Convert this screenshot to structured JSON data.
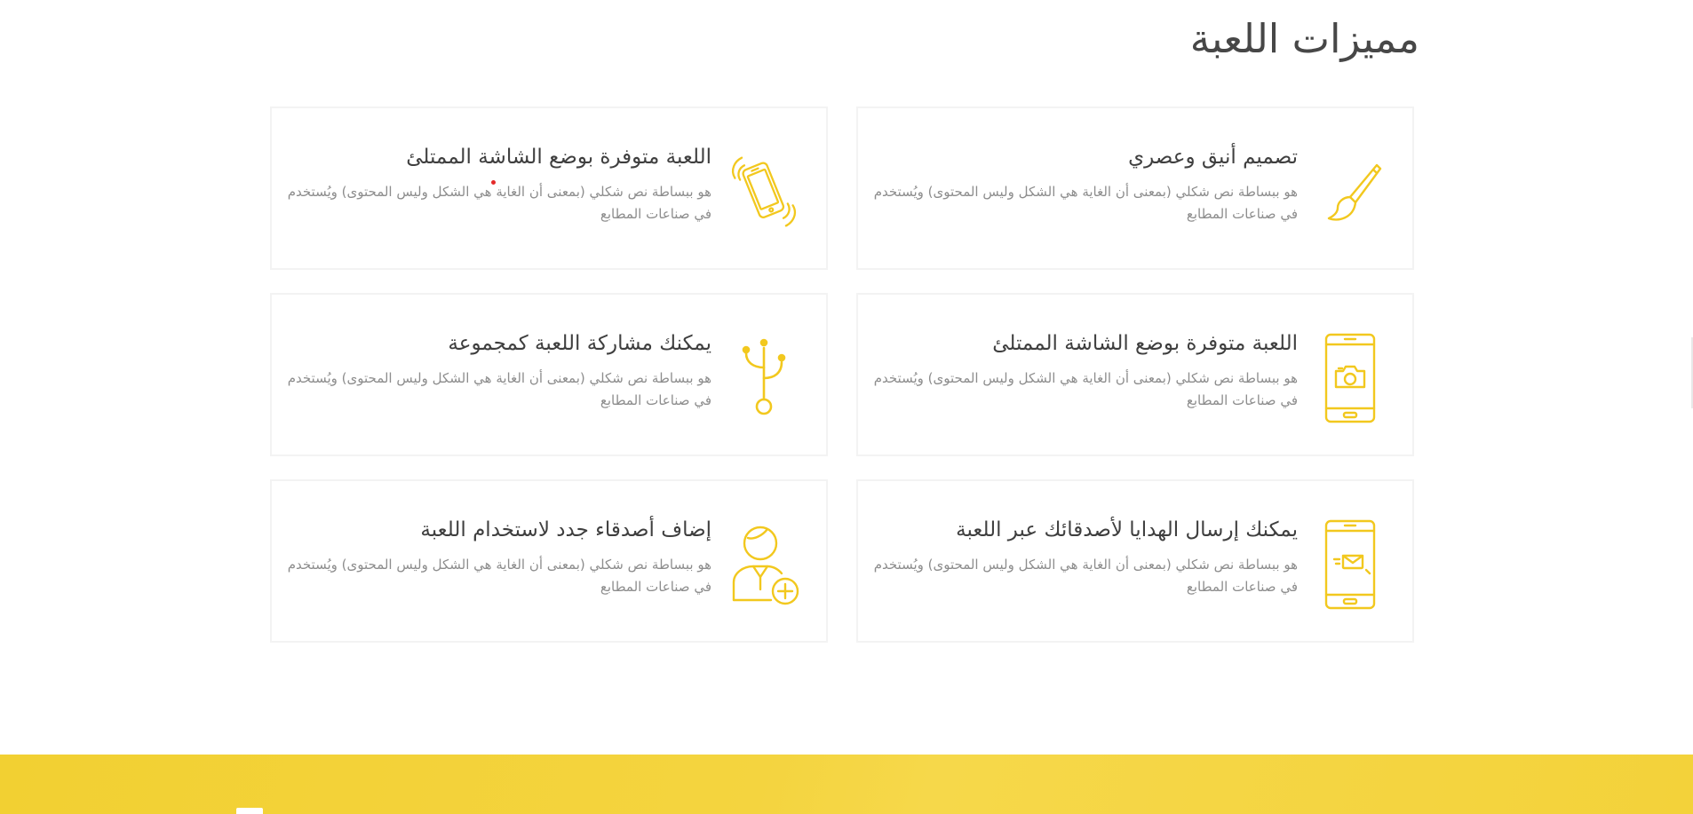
{
  "features": {
    "title": "مميزات اللعبة",
    "cards": [
      {
        "icon": "paintbrush-icon",
        "title": "تصميم أنيق وعصري",
        "description": "هو ببساطة نص شكلي (بمعنى أن الغاية هي الشكل وليس المحتوى) ويُستخدم في صناعات المطابع"
      },
      {
        "icon": "vibrating-phone-icon",
        "title": "اللعبة متوفرة بوضع الشاشة الممتلئ",
        "description": "هو ببساطة نص شكلي (بمعنى أن الغاية هي الشكل وليس المحتوى) ويُستخدم في صناعات المطابع"
      },
      {
        "icon": "phone-camera-icon",
        "title": "اللعبة متوفرة بوضع الشاشة الممتلئ",
        "description": "هو ببساطة نص شكلي (بمعنى أن الغاية هي الشكل وليس المحتوى) ويُستخدم في صناعات المطابع"
      },
      {
        "icon": "usb-icon",
        "title": "يمكنك مشاركة اللعبة كمجموعة",
        "description": "هو ببساطة نص شكلي (بمعنى أن الغاية هي الشكل وليس المحتوى) ويُستخدم في صناعات المطابع"
      },
      {
        "icon": "phone-message-icon",
        "title": "يمكنك إرسال الهدايا لأصدقائك عبر اللعبة",
        "description": "هو ببساطة نص شكلي (بمعنى أن الغاية هي الشكل وليس المحتوى) ويُستخدم في صناعات المطابع"
      },
      {
        "icon": "add-user-icon",
        "title": "إضاف أصدقاء جدد لاستخدام اللعبة",
        "description": "هو ببساطة نص شكلي (بمعنى أن الغاية هي الشكل وليس المحتوى) ويُستخدم في صناعات المطابع"
      }
    ]
  },
  "colors": {
    "accent": "#f5d43c",
    "icon": "#f2c81e",
    "title_text": "#474747",
    "body_text": "#8d8d8d",
    "card_border": "#f3f3f3"
  }
}
